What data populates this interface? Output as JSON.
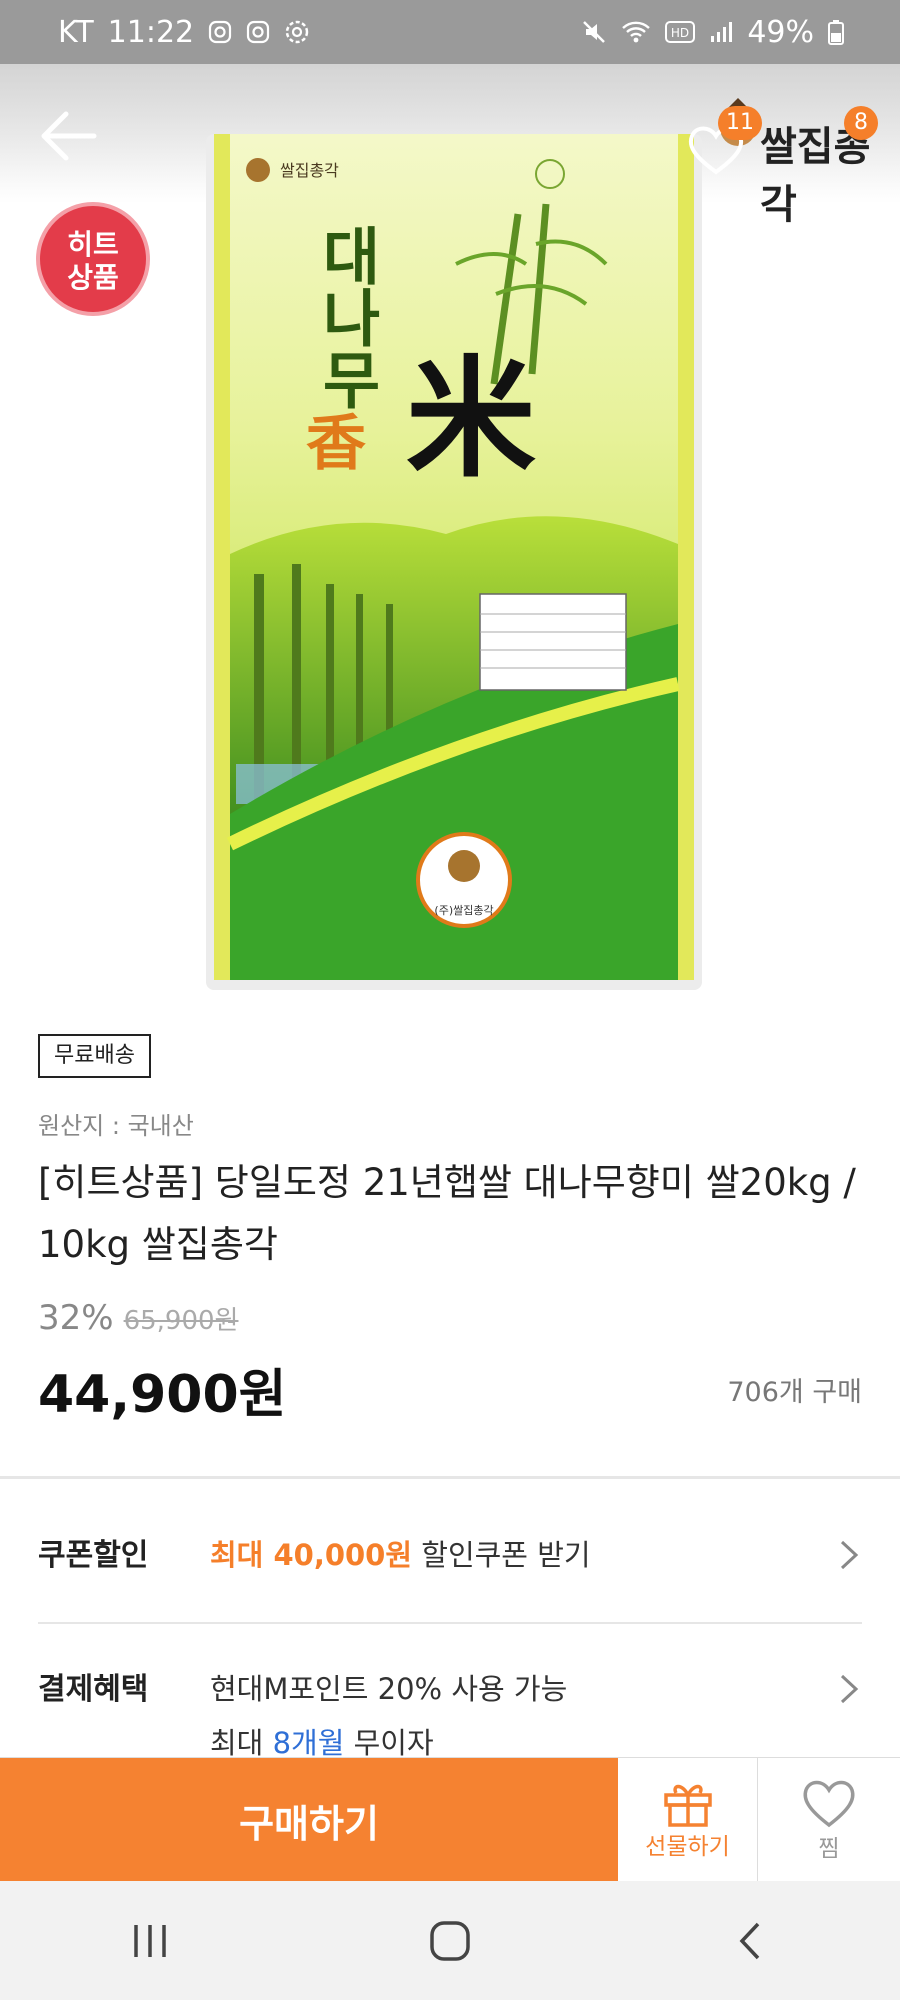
{
  "status_bar": {
    "carrier": "KT",
    "time": "11:22",
    "battery": "49%",
    "icons_left": [
      "instagram-icon",
      "instagram-icon",
      "settings-gear-icon"
    ],
    "icons_right": [
      "mute-icon",
      "wifi-icon",
      "hd-icon",
      "signal-icon",
      "battery-icon"
    ]
  },
  "header": {
    "back_icon": "arrow-left-icon",
    "wish_count": "11",
    "cart_count": "8",
    "seller_logo_text": "쌀집총각"
  },
  "product": {
    "hit_badge": "히트\n상품",
    "free_shipping": "무료배송",
    "origin": "원산지 : 국내산",
    "title": "[히트상품] 당일도정 21년햅쌀 대나무향미 쌀20kg / 10kg 쌀집총각",
    "discount_pct": "32%",
    "original_price": "65,900원",
    "price": "44,900원",
    "purchases": "706개 구매",
    "package": {
      "name_vertical": "대나무",
      "name_char": "香",
      "rice_char": "米",
      "brand": "쌀집총각",
      "seal_text": "(주)쌀집총각"
    }
  },
  "benefits": {
    "coupon_label": "쿠폰할인",
    "coupon_highlight": "최대 40,000원",
    "coupon_text": " 할인쿠폰 받기",
    "payment_label": "결제혜택",
    "payment_line1": "현대M포인트 20% 사용 가능",
    "payment_line2_prefix": "최대 ",
    "payment_line2_highlight": "8개월",
    "payment_line2_suffix": " 무이자"
  },
  "bottom_bar": {
    "buy_label": "구매하기",
    "gift_label": "선물하기",
    "zzim_label": "찜"
  },
  "colors": {
    "accent": "#f58231",
    "hit_badge": "#e33c4a",
    "blue_highlight": "#2f6fd6"
  }
}
